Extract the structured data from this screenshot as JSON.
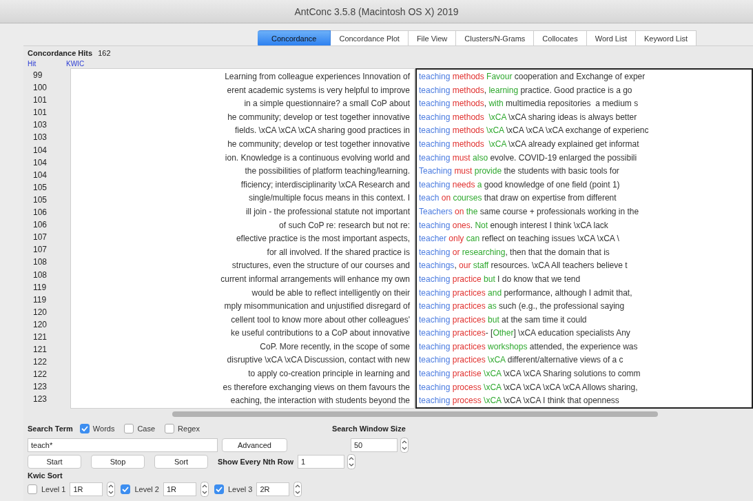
{
  "window": {
    "title": "AntConc 3.5.8 (Macintosh OS X) 2019"
  },
  "tabs": [
    {
      "label": "Concordance",
      "selected": true
    },
    {
      "label": "Concordance Plot",
      "selected": false
    },
    {
      "label": "File View",
      "selected": false
    },
    {
      "label": "Clusters/N-Grams",
      "selected": false
    },
    {
      "label": "Collocates",
      "selected": false
    },
    {
      "label": "Word List",
      "selected": false
    },
    {
      "label": "Keyword List",
      "selected": false
    }
  ],
  "concordance": {
    "hits_label": "Concordance Hits",
    "hits_count": "162",
    "column_headers": [
      "Hit",
      "KWIC"
    ],
    "hit_numbers": [
      "99",
      "100",
      "101",
      "101",
      "103",
      "103",
      "104",
      "104",
      "104",
      "105",
      "105",
      "106",
      "106",
      "107",
      "107",
      "108",
      "108",
      "119",
      "119",
      "120",
      "120",
      "121",
      "121",
      "122",
      "122",
      "123",
      "123"
    ],
    "lines": [
      {
        "left": "Learning from colleague experiences Innovation of",
        "right": [
          {
            "text": "teaching ",
            "kind": "node"
          },
          {
            "text": "methods ",
            "kind": "level1"
          },
          {
            "text": "Favour ",
            "kind": "level2"
          },
          {
            "text": "cooperation and Exchange of exper",
            "kind": "plain"
          }
        ]
      },
      {
        "left": "erent academic systems is very helpful to improve",
        "right": [
          {
            "text": "teaching ",
            "kind": "node"
          },
          {
            "text": "methods",
            "kind": "level1"
          },
          {
            "text": ", ",
            "kind": "plain"
          },
          {
            "text": "learning ",
            "kind": "level2"
          },
          {
            "text": "practice. Good practice is a go",
            "kind": "plain"
          }
        ]
      },
      {
        "left": "in a simple questionnaire? a small CoP about",
        "right": [
          {
            "text": "teaching ",
            "kind": "node"
          },
          {
            "text": "methods",
            "kind": "level1"
          },
          {
            "text": ", ",
            "kind": "plain"
          },
          {
            "text": "with ",
            "kind": "level2"
          },
          {
            "text": "multimedia repositories  a medium s",
            "kind": "plain"
          }
        ]
      },
      {
        "left": "he community; develop or test together innovative",
        "right": [
          {
            "text": "teaching ",
            "kind": "node"
          },
          {
            "text": "methods  ",
            "kind": "level1"
          },
          {
            "text": "\\xCA ",
            "kind": "level2"
          },
          {
            "text": "\\xCA sharing ideas is always better",
            "kind": "plain"
          }
        ]
      },
      {
        "left": "fields. \\xCA \\xCA \\xCA sharing good practices in",
        "right": [
          {
            "text": "teaching ",
            "kind": "node"
          },
          {
            "text": "methods ",
            "kind": "level1"
          },
          {
            "text": "\\xCA ",
            "kind": "level2"
          },
          {
            "text": "\\xCA \\xCA \\xCA exchange of experienc",
            "kind": "plain"
          }
        ]
      },
      {
        "left": "he community; develop or test together innovative",
        "right": [
          {
            "text": "teaching ",
            "kind": "node"
          },
          {
            "text": "methods  ",
            "kind": "level1"
          },
          {
            "text": "\\xCA ",
            "kind": "level2"
          },
          {
            "text": "\\xCA already explained get informat",
            "kind": "plain"
          }
        ]
      },
      {
        "left": "ion. Knowledge is a continuous evolving world and",
        "right": [
          {
            "text": "teaching ",
            "kind": "node"
          },
          {
            "text": "must ",
            "kind": "level1"
          },
          {
            "text": "also ",
            "kind": "level2"
          },
          {
            "text": "evolve. COVID-19 enlarged the possibili",
            "kind": "plain"
          }
        ]
      },
      {
        "left": "the possibilities of platform teaching/learning.",
        "right": [
          {
            "text": "Teaching ",
            "kind": "node"
          },
          {
            "text": "must ",
            "kind": "level1"
          },
          {
            "text": "provide ",
            "kind": "level2"
          },
          {
            "text": "the students with basic tools for",
            "kind": "plain"
          }
        ]
      },
      {
        "left": "fficiency; interdisciplinarity  \\xCA Research and",
        "right": [
          {
            "text": "teaching ",
            "kind": "node"
          },
          {
            "text": "needs ",
            "kind": "level1"
          },
          {
            "text": "a ",
            "kind": "level2"
          },
          {
            "text": "good knowledge of one field (point 1)",
            "kind": "plain"
          }
        ]
      },
      {
        "left": "single/multiple focus means in this context. I",
        "right": [
          {
            "text": "teach ",
            "kind": "node"
          },
          {
            "text": "on ",
            "kind": "level1"
          },
          {
            "text": "courses ",
            "kind": "level2"
          },
          {
            "text": "that draw on expertise from different",
            "kind": "plain"
          }
        ]
      },
      {
        "left": "ill join - the professional statute not important",
        "right": [
          {
            "text": "Teachers ",
            "kind": "node"
          },
          {
            "text": "on ",
            "kind": "level1"
          },
          {
            "text": "the ",
            "kind": "level2"
          },
          {
            "text": "same course + professionals working in the",
            "kind": "plain"
          }
        ]
      },
      {
        "left": "of such CoP re: research but not re:",
        "right": [
          {
            "text": "teaching ",
            "kind": "node"
          },
          {
            "text": "ones",
            "kind": "level1"
          },
          {
            "text": ". ",
            "kind": "plain"
          },
          {
            "text": "Not ",
            "kind": "level2"
          },
          {
            "text": "enough interest I think \\xCA lack",
            "kind": "plain"
          }
        ]
      },
      {
        "left": "eflective practice is the most important aspects,",
        "right": [
          {
            "text": "teacher ",
            "kind": "node"
          },
          {
            "text": "only ",
            "kind": "level1"
          },
          {
            "text": "can ",
            "kind": "level2"
          },
          {
            "text": "reflect on teaching issues \\xCA \\xCA \\",
            "kind": "plain"
          }
        ]
      },
      {
        "left": "for all involved. If the shared practice is",
        "right": [
          {
            "text": "teaching ",
            "kind": "node"
          },
          {
            "text": "or ",
            "kind": "level1"
          },
          {
            "text": "researching",
            "kind": "level2"
          },
          {
            "text": ", then that the domain that is",
            "kind": "plain"
          }
        ]
      },
      {
        "left": "structures, even the structure of our courses and",
        "right": [
          {
            "text": "teachings",
            "kind": "node"
          },
          {
            "text": ", ",
            "kind": "plain"
          },
          {
            "text": "our ",
            "kind": "level1"
          },
          {
            "text": "staff ",
            "kind": "level2"
          },
          {
            "text": "resources. \\xCA All teachers believe t",
            "kind": "plain"
          }
        ]
      },
      {
        "left": "current informal arrangements will enhance my own",
        "right": [
          {
            "text": "teaching ",
            "kind": "node"
          },
          {
            "text": "practice ",
            "kind": "level1"
          },
          {
            "text": "but ",
            "kind": "level2"
          },
          {
            "text": "I do know that we tend",
            "kind": "plain"
          }
        ]
      },
      {
        "left": "would be able to reflect intelligently on their",
        "right": [
          {
            "text": "teaching ",
            "kind": "node"
          },
          {
            "text": "practices ",
            "kind": "level1"
          },
          {
            "text": "and ",
            "kind": "level2"
          },
          {
            "text": "performance, although I admit that,",
            "kind": "plain"
          }
        ]
      },
      {
        "left": "mply misommunication and unjustified disregard of",
        "right": [
          {
            "text": "teaching ",
            "kind": "node"
          },
          {
            "text": "practices ",
            "kind": "level1"
          },
          {
            "text": "as ",
            "kind": "level2"
          },
          {
            "text": "such (e.g., the professional saying",
            "kind": "plain"
          }
        ]
      },
      {
        "left": "cellent tool to know more about other colleagues'",
        "right": [
          {
            "text": "teaching ",
            "kind": "node"
          },
          {
            "text": "practices ",
            "kind": "level1"
          },
          {
            "text": "but ",
            "kind": "level2"
          },
          {
            "text": "at the sam time it could",
            "kind": "plain"
          }
        ]
      },
      {
        "left": "ke useful contributions to a CoP about innovative",
        "right": [
          {
            "text": "teaching ",
            "kind": "node"
          },
          {
            "text": "practices",
            "kind": "level1"
          },
          {
            "text": "- [",
            "kind": "plain"
          },
          {
            "text": "Other",
            "kind": "level2"
          },
          {
            "text": "] \\xCA education specialists Any",
            "kind": "plain"
          }
        ]
      },
      {
        "left": "CoP. More recently, in the scope of some",
        "right": [
          {
            "text": "teaching ",
            "kind": "node"
          },
          {
            "text": "practices ",
            "kind": "level1"
          },
          {
            "text": "workshops ",
            "kind": "level2"
          },
          {
            "text": "attended, the experience was",
            "kind": "plain"
          }
        ]
      },
      {
        "left": "disruptive \\xCA \\xCA Discussion, contact with new",
        "right": [
          {
            "text": "teaching ",
            "kind": "node"
          },
          {
            "text": "practices ",
            "kind": "level1"
          },
          {
            "text": "\\xCA ",
            "kind": "level2"
          },
          {
            "text": "different/alternative views of a c",
            "kind": "plain"
          }
        ]
      },
      {
        "left": "to apply co-creation principle in learning and",
        "right": [
          {
            "text": "teaching ",
            "kind": "node"
          },
          {
            "text": "practise ",
            "kind": "level1"
          },
          {
            "text": "\\xCA ",
            "kind": "level2"
          },
          {
            "text": "\\xCA \\xCA Sharing solutions to comm",
            "kind": "plain"
          }
        ]
      },
      {
        "left": "es therefore exchanging views on them favours the",
        "right": [
          {
            "text": "teaching ",
            "kind": "node"
          },
          {
            "text": "process ",
            "kind": "level1"
          },
          {
            "text": "\\xCA ",
            "kind": "level2"
          },
          {
            "text": "\\xCA \\xCA \\xCA \\xCA Allows sharing,",
            "kind": "plain"
          }
        ]
      },
      {
        "left": "eaching, the interaction with students beyond the",
        "right": [
          {
            "text": "teaching ",
            "kind": "node"
          },
          {
            "text": "process ",
            "kind": "level1"
          },
          {
            "text": "\\xCA ",
            "kind": "level2"
          },
          {
            "text": "\\xCA \\xCA I think that openness",
            "kind": "plain"
          }
        ]
      }
    ]
  },
  "search": {
    "label": "Search Term",
    "options": [
      {
        "label": "Words",
        "checked": true
      },
      {
        "label": "Case",
        "checked": false
      },
      {
        "label": "Regex",
        "checked": false
      }
    ],
    "term": "teach*",
    "advanced_button": "Advanced",
    "window_size_label": "Search Window Size",
    "window_size": "50",
    "buttons": [
      "Start",
      "Stop",
      "Sort"
    ],
    "nth_row_label": "Show Every Nth Row",
    "nth_row": "1"
  },
  "kwic_sort": {
    "label": "Kwic Sort",
    "levels": [
      {
        "label": "Level 1",
        "checked": false,
        "value": "1R"
      },
      {
        "label": "Level 2",
        "checked": true,
        "value": "1R"
      },
      {
        "label": "Level 3",
        "checked": true,
        "value": "2R"
      }
    ]
  }
}
